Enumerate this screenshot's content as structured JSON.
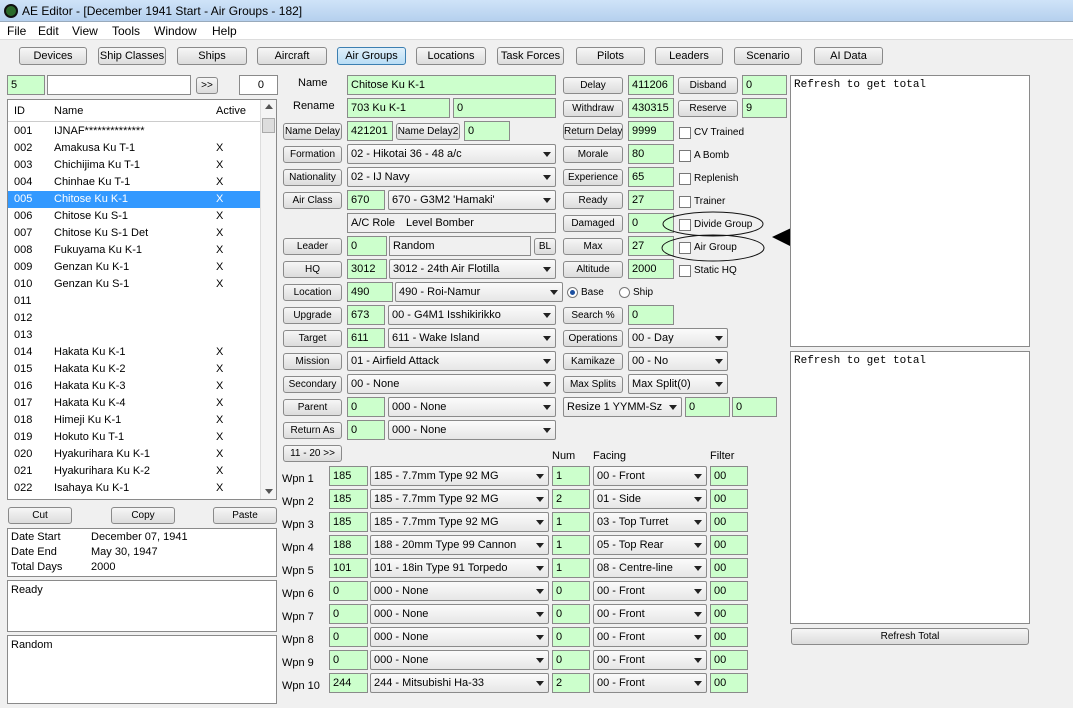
{
  "window": {
    "title": "AE Editor - [December 1941 Start - Air Groups - 182]"
  },
  "menu": [
    "File",
    "Edit",
    "View",
    "Tools",
    "Window",
    "Help"
  ],
  "toolbar": [
    "Devices",
    "Ship Classes",
    "Ships",
    "Aircraft",
    "Air Groups",
    "Locations",
    "Task Forces",
    "Pilots",
    "Leaders",
    "Scenario",
    "AI Data"
  ],
  "search": {
    "index": "5",
    "text": "",
    "go": ">>",
    "count": "0"
  },
  "list": {
    "headers": {
      "id": "ID",
      "name": "Name",
      "active": "Active"
    },
    "rows": [
      {
        "id": "001",
        "name": "IJNAF**************",
        "active": ""
      },
      {
        "id": "002",
        "name": "Amakusa Ku T-1",
        "active": "X"
      },
      {
        "id": "003",
        "name": "Chichijima Ku T-1",
        "active": "X"
      },
      {
        "id": "004",
        "name": "Chinhae Ku T-1",
        "active": "X"
      },
      {
        "id": "005",
        "name": "Chitose Ku K-1",
        "active": "X"
      },
      {
        "id": "006",
        "name": "Chitose Ku S-1",
        "active": "X"
      },
      {
        "id": "007",
        "name": "Chitose Ku S-1 Det",
        "active": "X"
      },
      {
        "id": "008",
        "name": "Fukuyama Ku K-1",
        "active": "X"
      },
      {
        "id": "009",
        "name": "Genzan Ku K-1",
        "active": "X"
      },
      {
        "id": "010",
        "name": "Genzan Ku S-1",
        "active": "X"
      },
      {
        "id": "011",
        "name": "",
        "active": ""
      },
      {
        "id": "012",
        "name": "",
        "active": ""
      },
      {
        "id": "013",
        "name": "",
        "active": ""
      },
      {
        "id": "014",
        "name": "Hakata Ku K-1",
        "active": "X"
      },
      {
        "id": "015",
        "name": "Hakata Ku K-2",
        "active": "X"
      },
      {
        "id": "016",
        "name": "Hakata Ku K-3",
        "active": "X"
      },
      {
        "id": "017",
        "name": "Hakata Ku K-4",
        "active": "X"
      },
      {
        "id": "018",
        "name": "Himeji Ku K-1",
        "active": "X"
      },
      {
        "id": "019",
        "name": "Hokuto Ku T-1",
        "active": "X"
      },
      {
        "id": "020",
        "name": "Hyakurihara Ku K-1",
        "active": "X"
      },
      {
        "id": "021",
        "name": "Hyakurihara Ku K-2",
        "active": "X"
      },
      {
        "id": "022",
        "name": "Isahaya Ku K-1",
        "active": "X"
      }
    ],
    "selected_index": 4
  },
  "clip": {
    "cut": "Cut",
    "copy": "Copy",
    "paste": "Paste"
  },
  "dates": {
    "start_label": "Date Start",
    "start": "December 07, 1941",
    "end_label": "Date End",
    "end": "May 30, 1947",
    "total_label": "Total Days",
    "total": "2000"
  },
  "status": {
    "ready": "Ready",
    "random": "Random"
  },
  "form": {
    "name_label": "Name",
    "name": "Chitose Ku K-1",
    "rename_label": "Rename",
    "rename": "703 Ku K-1",
    "rename_num": "0",
    "name_delay_btn": "Name Delay",
    "name_delay": "421201",
    "name_delay2_btn": "Name Delay2",
    "name_delay2": "0",
    "formation_btn": "Formation",
    "formation": "02 - Hikotai 36 - 48 a/c",
    "nationality_btn": "Nationality",
    "nationality": "02 - IJ Navy",
    "air_class_btn": "Air Class",
    "air_class_num": "670",
    "air_class": "670 - G3M2 'Hamaki'",
    "ac_role_label": "A/C Role",
    "ac_role": "Level Bomber",
    "leader_btn": "Leader",
    "leader_num": "0",
    "leader": "Random",
    "bl": "BL",
    "hq_btn": "HQ",
    "hq_num": "3012",
    "hq": "3012 - 24th Air Flotilla",
    "location_btn": "Location",
    "location_num": "490",
    "location": "490 - Roi-Namur",
    "upgrade_btn": "Upgrade",
    "upgrade_num": "673",
    "upgrade": "00 - G4M1 Isshikirikko",
    "target_btn": "Target",
    "target_num": "611",
    "target": "611 - Wake Island",
    "mission_btn": "Mission",
    "mission": "01 - Airfield Attack",
    "secondary_btn": "Secondary",
    "secondary": "00 - None",
    "parent_btn": "Parent",
    "parent_num": "0",
    "parent": "000 - None",
    "return_btn": "Return As",
    "return_num": "0",
    "return": "000 - None",
    "page_btn": "11 - 20 >>"
  },
  "stats": {
    "delay_btn": "Delay",
    "delay": "411206",
    "disband_btn": "Disband",
    "disband": "0",
    "withdraw_btn": "Withdraw",
    "withdraw": "430315",
    "reserve_btn": "Reserve",
    "reserve": "9",
    "return_delay_btn": "Return Delay",
    "return_delay": "9999",
    "morale_btn": "Morale",
    "morale": "80",
    "experience_btn": "Experience",
    "experience": "65",
    "ready_btn": "Ready",
    "ready": "27",
    "damaged_btn": "Damaged",
    "damaged": "0",
    "max_btn": "Max",
    "max": "27",
    "altitude_btn": "Altitude",
    "altitude": "2000",
    "base_label": "Base",
    "ship_label": "Ship",
    "search_btn": "Search %",
    "search": "0",
    "operations_btn": "Operations",
    "operations": "00 - Day",
    "kamikaze_btn": "Kamikaze",
    "kamikaze": "00 - No",
    "max_splits_btn": "Max Splits",
    "max_splits": "Max Split(0)",
    "resize": "Resize 1 YYMM-Sz",
    "resize_a": "0",
    "resize_b": "0"
  },
  "checks": [
    "CV Trained",
    "A Bomb",
    "Replenish",
    "Trainer",
    "Divide Group",
    "Air Group",
    "Static HQ"
  ],
  "weapons": {
    "num_header": "Num",
    "facing_header": "Facing",
    "filter_header": "Filter",
    "rows": [
      {
        "label": "Wpn 1",
        "code": "185",
        "device": "185 - 7.7mm Type 92 MG",
        "num": "1",
        "facing": "00 - Front",
        "filter": "00"
      },
      {
        "label": "Wpn 2",
        "code": "185",
        "device": "185 - 7.7mm Type 92 MG",
        "num": "2",
        "facing": "01 - Side",
        "filter": "00"
      },
      {
        "label": "Wpn 3",
        "code": "185",
        "device": "185 - 7.7mm Type 92 MG",
        "num": "1",
        "facing": "03 - Top Turret",
        "filter": "00"
      },
      {
        "label": "Wpn 4",
        "code": "188",
        "device": "188 - 20mm Type 99 Cannon",
        "num": "1",
        "facing": "05 - Top Rear",
        "filter": "00"
      },
      {
        "label": "Wpn 5",
        "code": "101",
        "device": "101 - 18in Type 91 Torpedo",
        "num": "1",
        "facing": "08 - Centre-line",
        "filter": "00"
      },
      {
        "label": "Wpn 6",
        "code": "0",
        "device": "000 - None",
        "num": "0",
        "facing": "00 - Front",
        "filter": "00"
      },
      {
        "label": "Wpn 7",
        "code": "0",
        "device": "000 - None",
        "num": "0",
        "facing": "00 - Front",
        "filter": "00"
      },
      {
        "label": "Wpn 8",
        "code": "0",
        "device": "000 - None",
        "num": "0",
        "facing": "00 - Front",
        "filter": "00"
      },
      {
        "label": "Wpn 9",
        "code": "0",
        "device": "000 - None",
        "num": "0",
        "facing": "00 - Front",
        "filter": "00"
      },
      {
        "label": "Wpn 10",
        "code": "244",
        "device": "244 - Mitsubishi Ha-33",
        "num": "2",
        "facing": "00 - Front",
        "filter": "00"
      }
    ]
  },
  "totals": {
    "top": "Refresh to get total",
    "bottom": "Refresh to get total",
    "refresh_btn": "Refresh Total"
  }
}
